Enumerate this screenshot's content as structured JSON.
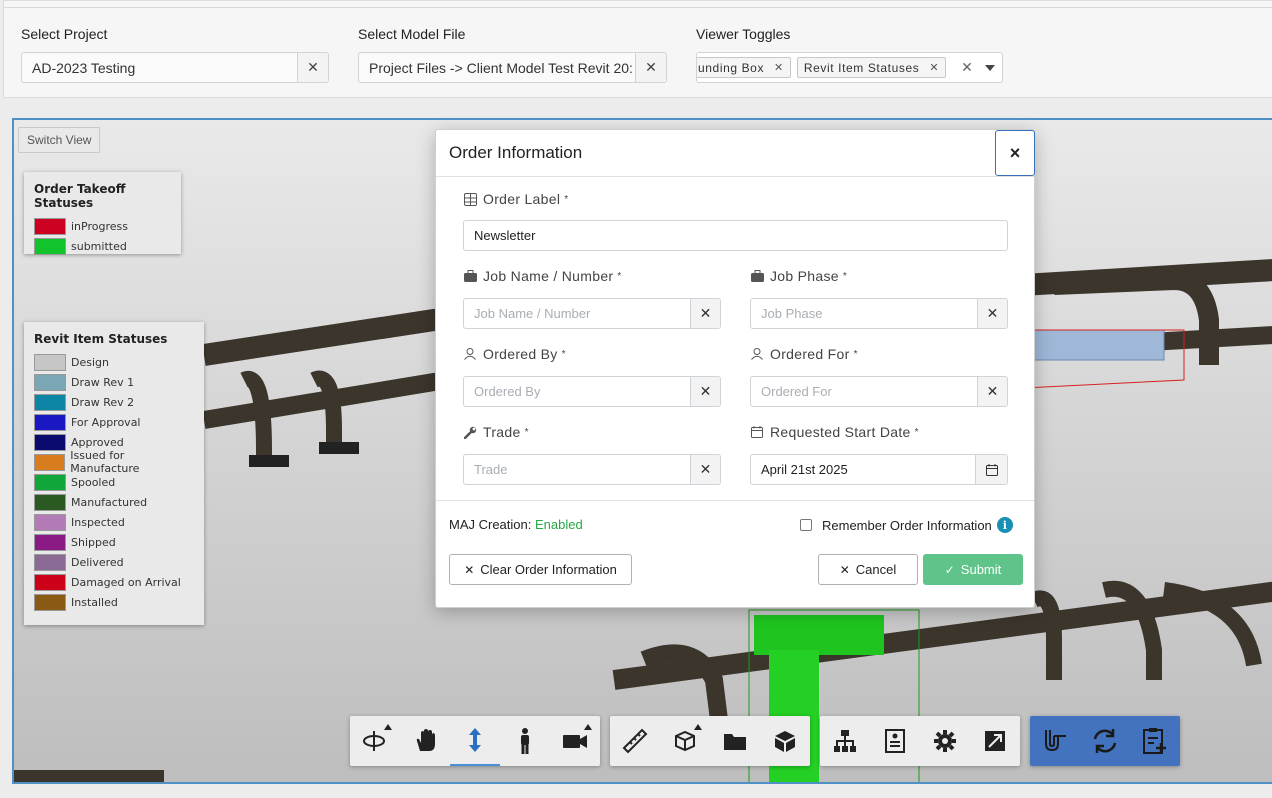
{
  "filters": {
    "project": {
      "label": "Select Project",
      "value": "AD-2023 Testing"
    },
    "model": {
      "label": "Select Model File",
      "value": "Project Files -> Client Model Test Revit 20:"
    },
    "toggles": {
      "label": "Viewer Toggles",
      "tags": [
        "unding Box",
        "Revit Item Statuses"
      ]
    },
    "clear_glyph": "✕"
  },
  "viewer": {
    "switch_label": "Switch View",
    "order_legend": {
      "title": "Order Takeoff Statuses",
      "items": [
        {
          "label": "inProgress",
          "color": "#cc0020"
        },
        {
          "label": "submitted",
          "color": "#11c42c"
        }
      ]
    },
    "revit_legend": {
      "title": "Revit Item Statuses",
      "items": [
        {
          "label": "Design",
          "color": "#c6c6c6"
        },
        {
          "label": "Draw Rev 1",
          "color": "#7aa6b6"
        },
        {
          "label": "Draw Rev 2",
          "color": "#0d86a6"
        },
        {
          "label": "For Approval",
          "color": "#1a18c2"
        },
        {
          "label": "Approved",
          "color": "#0b0a6e"
        },
        {
          "label": "Issued for Manufacture",
          "color": "#d77d1e"
        },
        {
          "label": "Spooled",
          "color": "#11a63a"
        },
        {
          "label": "Manufactured",
          "color": "#2a5a22"
        },
        {
          "label": "Inspected",
          "color": "#b27bb6"
        },
        {
          "label": "Shipped",
          "color": "#8a1a86"
        },
        {
          "label": "Delivered",
          "color": "#8b6a96"
        },
        {
          "label": "Damaged on Arrival",
          "color": "#cc0018"
        },
        {
          "label": "Installed",
          "color": "#8a5a14"
        }
      ]
    }
  },
  "modal": {
    "title": "Order Information",
    "close_glyph": "×",
    "required_mark": "*",
    "fields": {
      "order_label": {
        "label": "Order Label",
        "value": "Newsletter"
      },
      "job_name": {
        "label": "Job Name / Number",
        "placeholder": "Job Name / Number"
      },
      "job_phase": {
        "label": "Job Phase",
        "placeholder": "Job Phase"
      },
      "ordered_by": {
        "label": "Ordered By",
        "placeholder": "Ordered By"
      },
      "ordered_for": {
        "label": "Ordered For",
        "placeholder": "Ordered For"
      },
      "trade": {
        "label": "Trade",
        "placeholder": "Trade"
      },
      "start_date": {
        "label": "Requested Start Date",
        "value": "April 21st 2025"
      }
    },
    "maj_label": "MAJ Creation:",
    "maj_status": "Enabled",
    "remember_label": "Remember Order Information",
    "info_glyph": "i",
    "clear_button": "Clear Order Information",
    "cancel_button": "Cancel",
    "submit_button": "Submit"
  },
  "toolbar": {
    "groups": [
      {
        "buttons": [
          "orbit-icon",
          "pan-icon",
          "zoom-icon",
          "first-person-icon",
          "camera-icon"
        ]
      },
      {
        "buttons": [
          "measure-icon",
          "section-icon",
          "folder-icon",
          "model-icon"
        ]
      },
      {
        "buttons": [
          "model-tree-icon",
          "properties-icon",
          "settings-icon",
          "fullscreen-icon"
        ]
      },
      {
        "buttons": [
          "pipe-icon",
          "refresh-icon",
          "add-order-icon"
        ]
      }
    ],
    "active_button": "zoom-icon",
    "colors": {
      "accent": "#4372bf",
      "submit": "#5fc48a",
      "enabled": "#28a745"
    }
  }
}
